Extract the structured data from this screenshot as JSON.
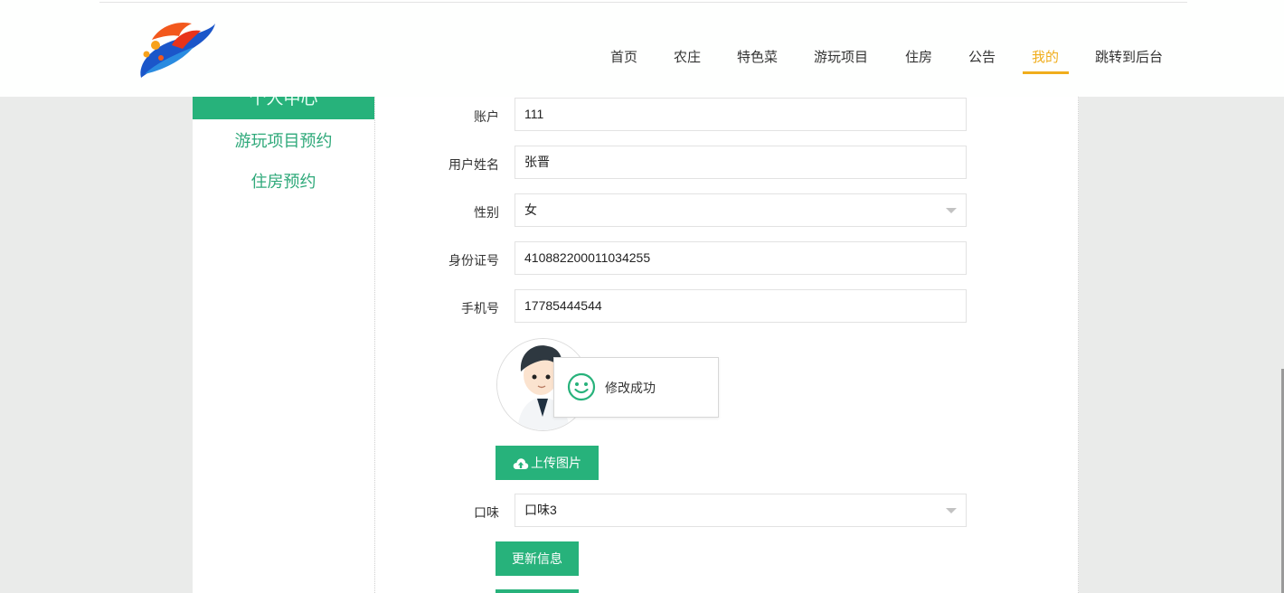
{
  "nav": {
    "items": [
      "首页",
      "农庄",
      "特色菜",
      "游玩项目",
      "住房",
      "公告",
      "我的",
      "跳转到后台"
    ],
    "active_index": 6
  },
  "sidebar": {
    "header": "个人中心",
    "links": [
      "游玩项目预约",
      "住房预约"
    ]
  },
  "form": {
    "account_label": "账户",
    "account_value": "111",
    "name_label": "用户姓名",
    "name_value": "张晋",
    "gender_label": "性别",
    "gender_value": "女",
    "id_label": "身份证号",
    "id_value": "410882200011034255",
    "phone_label": "手机号",
    "phone_value": "17785444544",
    "upload_label": "上传图片",
    "taste_label": "口味",
    "taste_value": "口味3",
    "submit_label": "更新信息"
  },
  "toast": {
    "message": "修改成功",
    "icon": "smile-icon"
  },
  "colors": {
    "primary": "#27b27b",
    "nav_active": "#f0ad1c",
    "page_bg": "#eaebea"
  }
}
